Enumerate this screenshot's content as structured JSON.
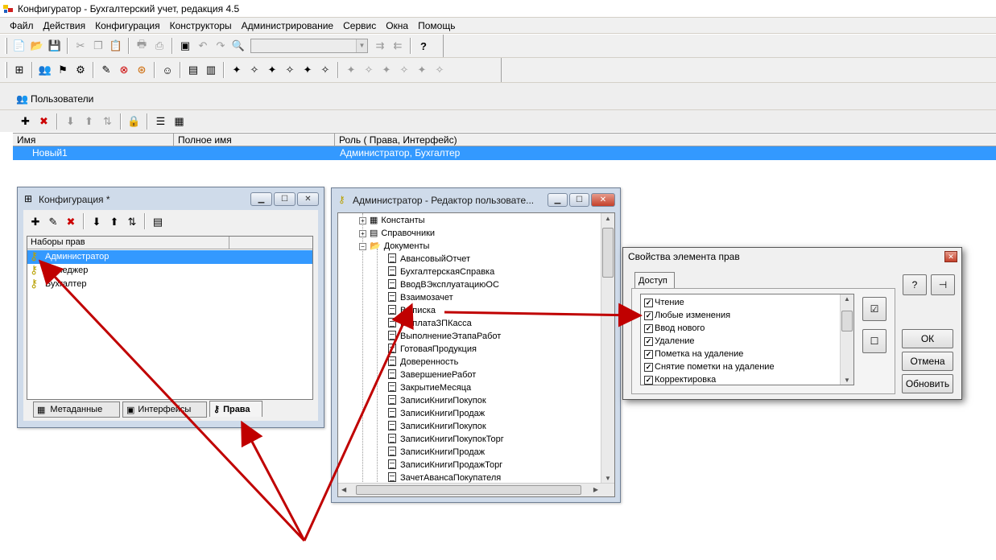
{
  "app": {
    "title": "Конфигуратор - Бухгалтерский учет, редакция 4.5"
  },
  "menu": [
    "Файл",
    "Действия",
    "Конфигурация",
    "Конструкторы",
    "Администрирование",
    "Сервис",
    "Окна",
    "Помощь"
  ],
  "users_window": {
    "title": "Пользователи",
    "columns": [
      "Имя",
      "Полное имя",
      "Роль ( Права, Интерфейс)"
    ],
    "rows": [
      {
        "name": "Новый1",
        "full_name": "",
        "role": "Администратор, Бухгалтер"
      }
    ]
  },
  "config_window": {
    "title": "Конфигурация *",
    "columns": [
      "Наборы прав",
      ""
    ],
    "rights_sets": [
      "Администратор",
      "Менеджер",
      "Бухгалтер"
    ],
    "tabs": [
      "Метаданные",
      "Интерфейсы",
      "Права"
    ],
    "active_tab": "Права"
  },
  "editor_window": {
    "title": "Администратор - Редактор пользовате...",
    "folders": [
      "Константы",
      "Справочники",
      "Документы"
    ],
    "documents": [
      "АвансовыйОтчет",
      "БухгалтерскаяСправка",
      "ВводВЭксплуатациюОС",
      "Взаимозачет",
      "Выписка",
      "ВыплатаЗПКасса",
      "ВыполнениеЭтапаРабот",
      "ГотоваяПродукция",
      "Доверенность",
      "ЗавершениеРабот",
      "ЗакрытиеМесяца",
      "ЗаписиКнигиПокупок",
      "ЗаписиКнигиПродаж",
      "ЗаписиКнигиПокупок",
      "ЗаписиКнигиПокупокТорг",
      "ЗаписиКнигиПродаж",
      "ЗаписиКнигиПродажТорг",
      "ЗачетАвансаПокупателя"
    ]
  },
  "props_dialog": {
    "title": "Свойства элемента прав",
    "tab": "Доступ",
    "rights": [
      "Чтение",
      "Любые изменения",
      "Ввод нового",
      "Удаление",
      "Пометка на удаление",
      "Снятие пометки на удаление",
      "Корректировка"
    ],
    "buttons": {
      "ok": "ОК",
      "cancel": "Отмена",
      "refresh": "Обновить"
    }
  },
  "colors": {
    "selection": "#3399ff",
    "arrow": "#c00000",
    "window_frame": "#cfdbea"
  }
}
